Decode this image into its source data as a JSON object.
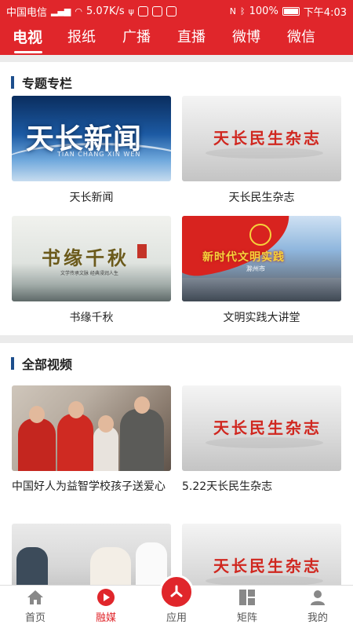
{
  "status_bar": {
    "carrier": "中国电信",
    "net_speed": "5.07K/s",
    "battery": "100%",
    "time": "下午4:03"
  },
  "tabs": [
    {
      "label": "电视",
      "active": true
    },
    {
      "label": "报纸",
      "active": false
    },
    {
      "label": "广播",
      "active": false
    },
    {
      "label": "直播",
      "active": false
    },
    {
      "label": "微博",
      "active": false
    },
    {
      "label": "微信",
      "active": false
    }
  ],
  "special": {
    "title": "专题专栏",
    "items": [
      {
        "label": "天长新闻",
        "thumb_text": "天长新闻",
        "thumb_sub": "TIAN CHANG XIN WEN"
      },
      {
        "label": "天长民生杂志",
        "thumb_text": "天长民生杂志"
      },
      {
        "label": "书缘千秋",
        "thumb_text": "书缘千秋",
        "thumb_sub": "文学传承文脉 经典浸润人生"
      },
      {
        "label": "文明实践大讲堂",
        "thumb_text": "新时代文明实践",
        "thumb_sub": "滁州市"
      }
    ]
  },
  "videos": {
    "title": "全部视频",
    "items": [
      {
        "label": "中国好人为益智学校孩子送爱心"
      },
      {
        "label": "5.22天长民生杂志",
        "thumb_text": "天长民生杂志"
      },
      {
        "label": ""
      },
      {
        "label": "",
        "thumb_text": "天长民生杂志"
      }
    ]
  },
  "bottom_nav": [
    {
      "label": "首页",
      "icon": "home-icon",
      "active": false
    },
    {
      "label": "融媒",
      "icon": "play-icon",
      "active": true
    },
    {
      "label": "应用",
      "icon": "apps-icon",
      "active": false
    },
    {
      "label": "矩阵",
      "icon": "matrix-icon",
      "active": false
    },
    {
      "label": "我的",
      "icon": "profile-icon",
      "active": false
    }
  ],
  "colors": {
    "brand_red": "#e0262b",
    "section_bar": "#1d4e8c"
  }
}
